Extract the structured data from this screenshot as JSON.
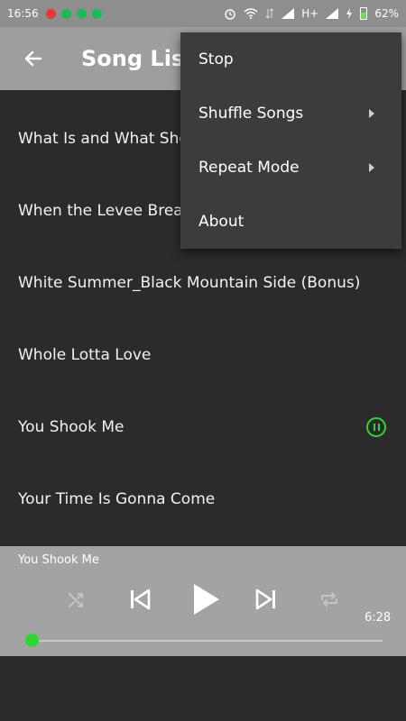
{
  "status_bar": {
    "time": "16:56",
    "network": "H+",
    "battery": "62%",
    "battery_level": 0.62
  },
  "header": {
    "title": "Song List"
  },
  "songs": [
    "What Is and What Shou",
    "When the Levee Breaks",
    "White Summer_Black Mountain Side (Bonus)",
    "Whole Lotta Love",
    "You Shook Me",
    "Your Time Is Gonna Come"
  ],
  "menu": {
    "items": [
      {
        "label": "Stop",
        "has_submenu": false
      },
      {
        "label": "Shuffle Songs",
        "has_submenu": true
      },
      {
        "label": "Repeat Mode",
        "has_submenu": true
      },
      {
        "label": "About",
        "has_submenu": false
      }
    ]
  },
  "player": {
    "now_playing": "You Shook Me",
    "duration": "6:28",
    "progress": 0.01
  },
  "colors": {
    "accent": "#2fd62f",
    "app_bar": "#9e9e9e",
    "status_bar": "#8e8e8e",
    "background": "#2b2b2b",
    "menu": "#3c3c3c",
    "player": "#a3a3a3"
  },
  "icons": {
    "back": "arrow-left-icon",
    "shuffle": "shuffle-icon",
    "previous": "skip-previous-icon",
    "play": "play-icon",
    "next": "skip-next-icon",
    "repeat": "repeat-icon",
    "now_playing": "pause-circle-icon"
  }
}
